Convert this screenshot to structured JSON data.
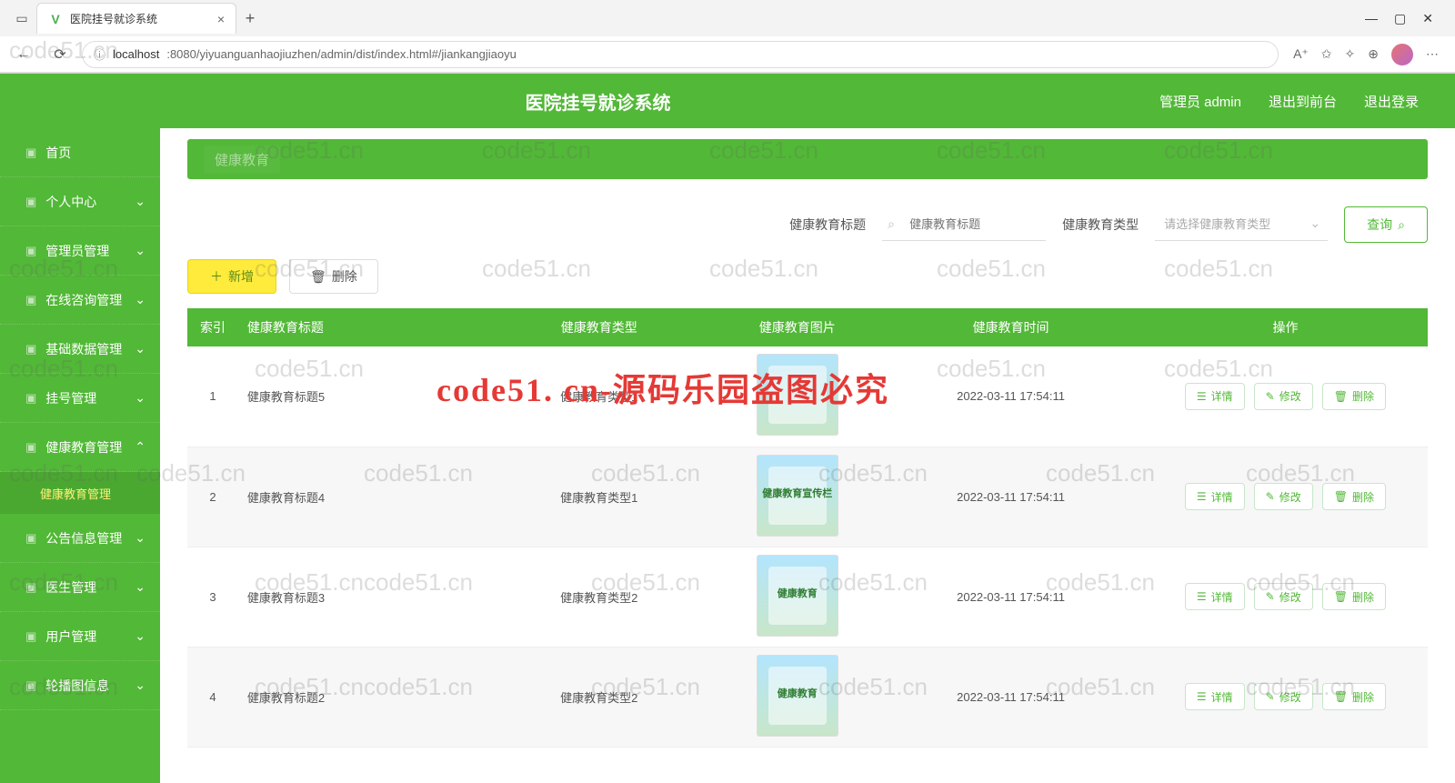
{
  "browser": {
    "tab_title": "医院挂号就诊系统",
    "url_host": "localhost",
    "url_path": ":8080/yiyuanguanhaojiuzhen/admin/dist/index.html#/jiankangjiaoyu"
  },
  "header": {
    "app_title": "医院挂号就诊系统",
    "user_label": "管理员 admin",
    "logout_front": "退出到前台",
    "logout": "退出登录"
  },
  "sidebar": {
    "home": "首页",
    "items": [
      {
        "label": "个人中心"
      },
      {
        "label": "管理员管理"
      },
      {
        "label": "在线咨询管理"
      },
      {
        "label": "基础数据管理"
      },
      {
        "label": "挂号管理"
      },
      {
        "label": "健康教育管理",
        "expanded": true,
        "sub": "健康教育管理"
      },
      {
        "label": "公告信息管理"
      },
      {
        "label": "医生管理"
      },
      {
        "label": "用户管理"
      },
      {
        "label": "轮播图信息"
      }
    ]
  },
  "breadcrumb": {
    "current": "健康教育"
  },
  "filters": {
    "title_label": "健康教育标题",
    "title_placeholder": "健康教育标题",
    "type_label": "健康教育类型",
    "type_placeholder": "请选择健康教育类型",
    "query": "查询"
  },
  "actions": {
    "add": "新增",
    "delete": "删除"
  },
  "table": {
    "headers": {
      "idx": "索引",
      "title": "健康教育标题",
      "type": "健康教育类型",
      "img": "健康教育图片",
      "time": "健康教育时间",
      "ops": "操作"
    },
    "ops": {
      "detail": "详情",
      "edit": "修改",
      "delete": "删除"
    },
    "rows": [
      {
        "idx": "1",
        "title": "健康教育标题5",
        "type": "健康教育类型1",
        "time": "2022-03-11 17:54:11",
        "thumb_label": ""
      },
      {
        "idx": "2",
        "title": "健康教育标题4",
        "type": "健康教育类型1",
        "time": "2022-03-11 17:54:11",
        "thumb_label": "健康教育宣传栏"
      },
      {
        "idx": "3",
        "title": "健康教育标题3",
        "type": "健康教育类型2",
        "time": "2022-03-11 17:54:11",
        "thumb_label": "健康教育"
      },
      {
        "idx": "4",
        "title": "健康教育标题2",
        "type": "健康教育类型2",
        "time": "2022-03-11 17:54:11",
        "thumb_label": "健康教育"
      }
    ]
  },
  "watermark": {
    "grey": "code51.cn",
    "red": "code51. cn-源码乐园盗图必究"
  }
}
